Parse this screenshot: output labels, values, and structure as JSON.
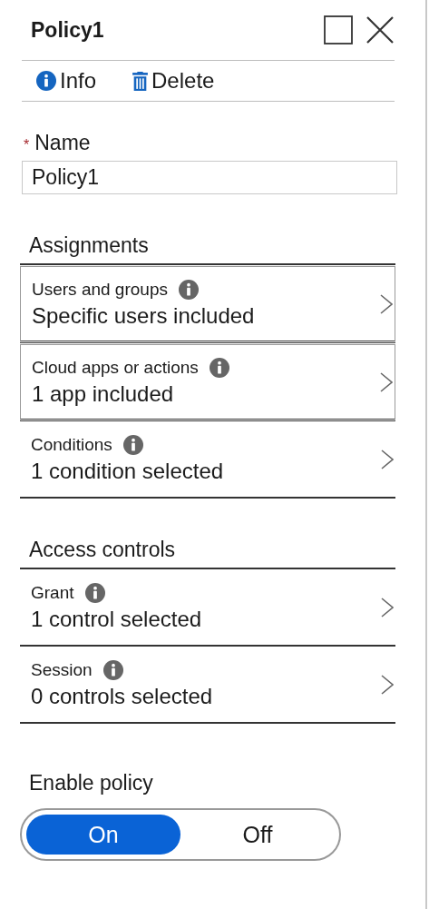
{
  "window": {
    "title": "Policy1"
  },
  "toolbar": [
    {
      "label": "Info",
      "kind": "info"
    },
    {
      "label": "Delete",
      "kind": "delete"
    }
  ],
  "name_field": {
    "label": "Name",
    "required_mark": "*",
    "value": "Policy1"
  },
  "sections": [
    {
      "heading": "Assignments",
      "rows": [
        {
          "label": "Users and groups",
          "value": "Specific users included",
          "selected": true
        },
        {
          "label": "Cloud apps or actions",
          "value": "1 app included",
          "selected": true
        },
        {
          "label": "Conditions",
          "value": "1 condition selected",
          "selected": false
        }
      ]
    },
    {
      "heading": "Access controls",
      "rows": [
        {
          "label": "Grant",
          "value": "1 control selected",
          "selected": false
        },
        {
          "label": "Session",
          "value": "0 controls selected",
          "selected": false
        }
      ]
    }
  ],
  "enable_policy": {
    "label": "Enable policy",
    "options": [
      {
        "label": "On",
        "selected": true
      },
      {
        "label": "Off",
        "selected": false
      }
    ]
  }
}
